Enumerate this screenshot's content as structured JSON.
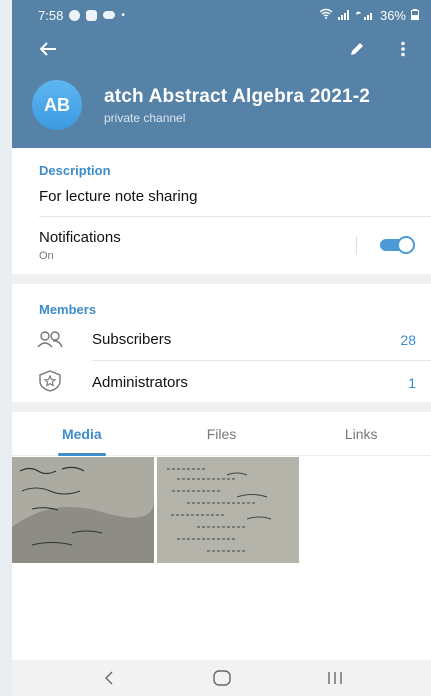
{
  "status_bar": {
    "time": "7:58",
    "battery": "36%"
  },
  "channel": {
    "avatar_initials": "AB",
    "title": "atch   Abstract Algebra 2021-2",
    "subtitle": "private channel"
  },
  "description": {
    "label": "Description",
    "text": "For lecture note sharing"
  },
  "notifications": {
    "title": "Notifications",
    "state": "On",
    "enabled": true
  },
  "members": {
    "label": "Members",
    "rows": [
      {
        "label": "Subscribers",
        "count": "28",
        "icon": "people-icon"
      },
      {
        "label": "Administrators",
        "count": "1",
        "icon": "admin-badge-icon"
      }
    ]
  },
  "tabs": [
    {
      "label": "Media",
      "active": true
    },
    {
      "label": "Files",
      "active": false
    },
    {
      "label": "Links",
      "active": false
    }
  ],
  "colors": {
    "header": "#5682a8",
    "accent": "#3d8ccc",
    "avatar": "#4aa6e8"
  }
}
